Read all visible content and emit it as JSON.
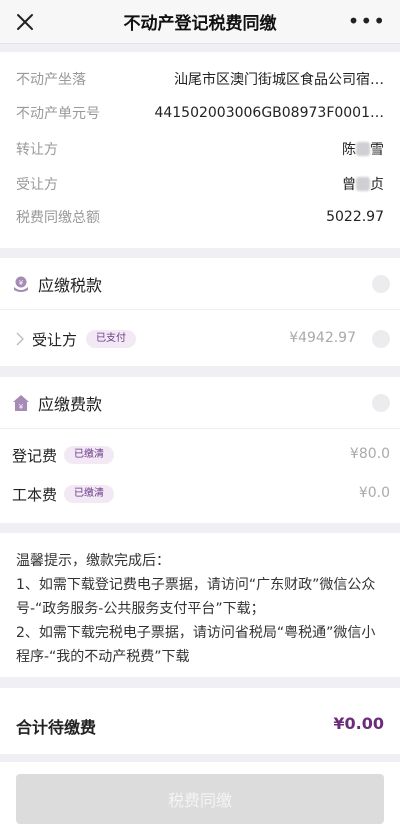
{
  "header": {
    "title": "不动产登记税费同缴",
    "more": "•••"
  },
  "info": {
    "location_label": "不动产坐落",
    "location_value": "汕尾市区澳门街城区食品公司宿…",
    "unit_label": "不动产单元号",
    "unit_value": "441502003006GB08973F0001…",
    "transferor_label": "转让方",
    "transferor_first": "陈",
    "transferor_last": "雪",
    "transferee_label": "受让方",
    "transferee_first": "曾",
    "transferee_last": "贞",
    "total_label": "税费同缴总额",
    "total_value": "5022.97"
  },
  "tax": {
    "title": "应缴税款",
    "row_label": "受让方",
    "row_badge": "已支付",
    "row_amount": "¥4942.97"
  },
  "fee": {
    "title": "应缴费款",
    "rows": [
      {
        "label": "登记费",
        "badge": "已缴清",
        "amount": "¥80.0"
      },
      {
        "label": "工本费",
        "badge": "已缴清",
        "amount": "¥0.0"
      }
    ]
  },
  "tip": {
    "line1": "温馨提示，缴款完成后：",
    "line2": "1、如需下载登记费电子票据，请访问“广东财政”微信公众号-“政务服务-公共服务支付平台”下载；",
    "line3": "2、如需下载完税电子票据，请访问省税局“粤税通”微信小程序-“我的不动产税费”下载"
  },
  "total": {
    "label": "合计待缴费",
    "value": "¥0.00"
  },
  "footer": {
    "button": "税费同缴"
  },
  "colors": {
    "accent": "#6b2c7a",
    "badge_bg": "#f2e9f5",
    "page_bg": "#efeff4"
  }
}
